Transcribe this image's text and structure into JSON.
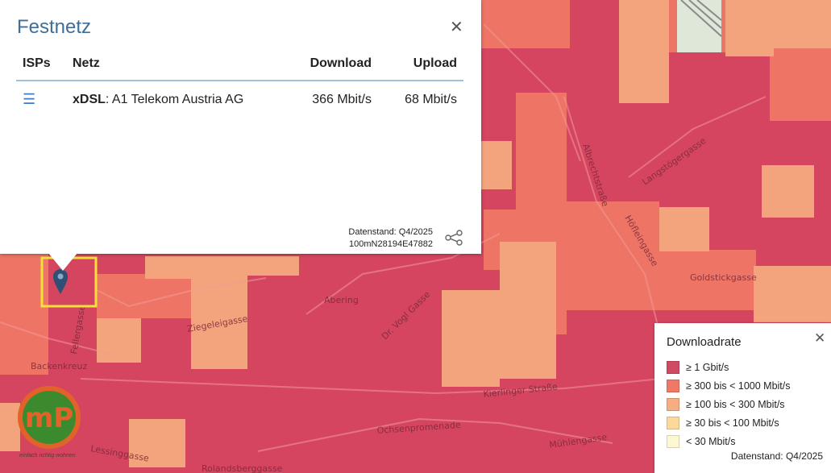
{
  "popup": {
    "title": "Festnetz",
    "columns": {
      "isps": "ISPs",
      "netz": "Netz",
      "download": "Download",
      "upload": "Upload"
    },
    "row": {
      "tech": "xDSL",
      "provider": ": A1 Telekom Austria AG",
      "download": "366 Mbit/s",
      "upload": "68 Mbit/s"
    },
    "footer_date": "Datenstand: Q4/2025",
    "footer_id": "100mN28194E47882"
  },
  "legend": {
    "title": "Downloadrate",
    "items": [
      {
        "label": "≥ 1 Gbit/s",
        "color": "#cf4a63"
      },
      {
        "label": "≥ 300 bis < 1000 Mbit/s",
        "color": "#ef7967"
      },
      {
        "label": "≥ 100 bis < 300 Mbit/s",
        "color": "#f6ad82"
      },
      {
        "label": "≥ 30 bis < 100 Mbit/s",
        "color": "#fbd99d"
      },
      {
        "label": "< 30 Mbit/s",
        "color": "#fdf7d2"
      }
    ],
    "date": "Datenstand: Q4/2025"
  },
  "map": {
    "streets": [
      "Albrechtstraße",
      "Kierlinger Straße",
      "Höfleingasse",
      "Abering",
      "Dr. Vogl Gasse",
      "Fellergasse",
      "Lessinggasse",
      "Rolandsberggasse",
      "Mühlengasse",
      "Ochsenpromenade",
      "Langstögergasse",
      "Goldstickgasse",
      "Backenkreuz",
      "Ziegeleigasse"
    ]
  },
  "colors": {
    "gigabit": "#d64560",
    "high": "#ee7565",
    "mid": "#f4a47c",
    "selection": "#f3e13a",
    "marker": "#2f4f75",
    "accent": "#3f6e97"
  },
  "logo": {
    "text": "mP",
    "tagline": "einfach richtig wohnen"
  }
}
